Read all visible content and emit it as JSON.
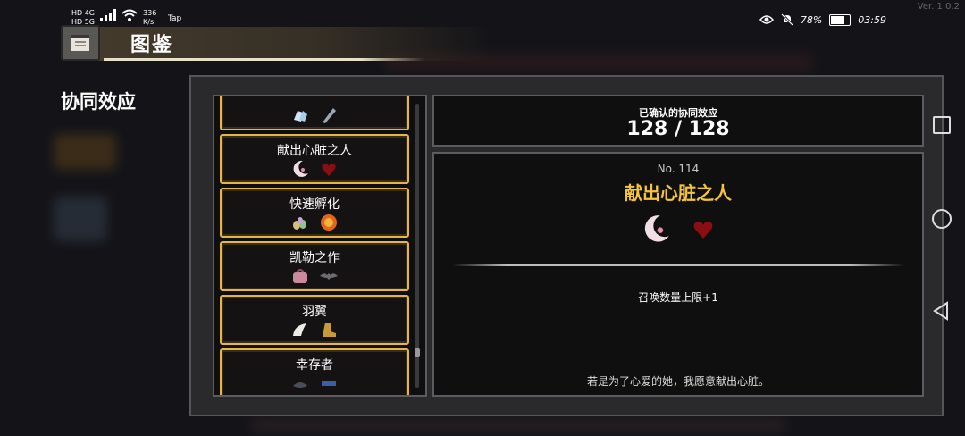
{
  "status_bar": {
    "sim1": "HD 4G",
    "sim2": "HD 5G",
    "network_speed": "336 K/s",
    "app_indicator": "Tap",
    "battery_percent": "78%",
    "time": "03:59"
  },
  "version": "Ver. 1.0.2",
  "header": {
    "title": "图鉴"
  },
  "section_title": "协同效应",
  "synergy_list": [
    {
      "label": "",
      "icons": [
        "ice-crystal-icon",
        "feather-blade-icon"
      ]
    },
    {
      "label": "献出心脏之人",
      "icons": [
        "crescent-moon-icon",
        "red-heart-icon"
      ]
    },
    {
      "label": "快速孵化",
      "icons": [
        "egg-cluster-icon",
        "fire-orb-icon"
      ]
    },
    {
      "label": "凯勒之作",
      "icons": [
        "pink-bag-icon",
        "bat-icon"
      ]
    },
    {
      "label": "羽翼",
      "icons": [
        "wing-icon",
        "boot-icon"
      ]
    },
    {
      "label": "幸存者",
      "icons": [
        "cloak-icon",
        "gear-chain-icon"
      ]
    }
  ],
  "count": {
    "label": "已确认的协同效应",
    "value": "128 / 128"
  },
  "detail": {
    "number": "No. 114",
    "name": "献出心脏之人",
    "icons": [
      "crescent-moon-icon",
      "red-heart-icon"
    ],
    "effect": "召唤数量上限+1",
    "flavor": "若是为了心爱的她，我愿意献出心脏。"
  },
  "colors": {
    "accent_gold": "#e3b54a",
    "title_yellow": "#f4c43a",
    "panel_bg": "#2a2a2c"
  }
}
